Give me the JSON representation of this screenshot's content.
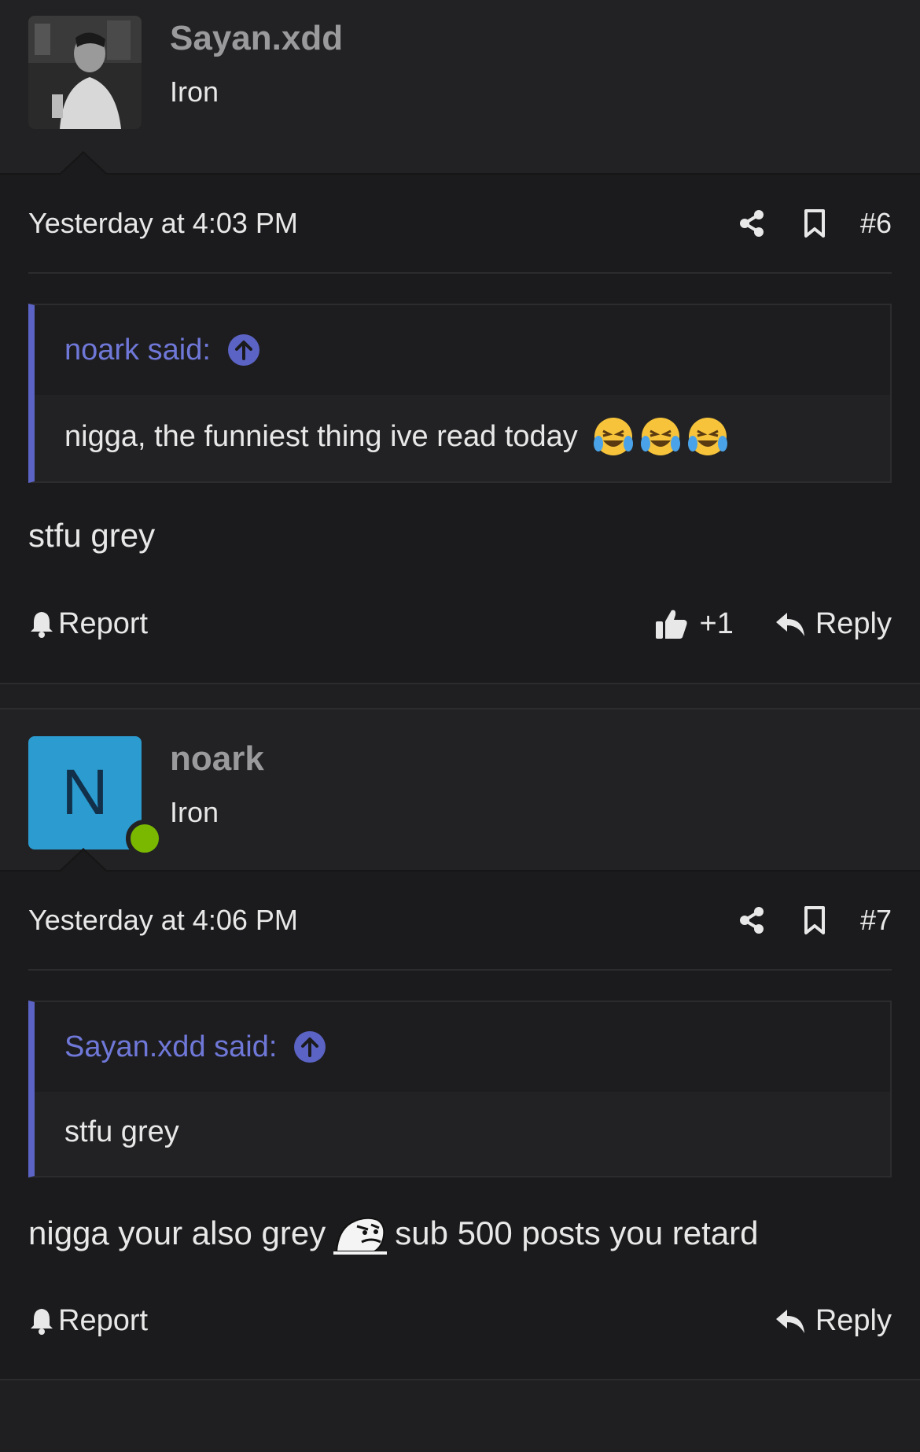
{
  "posts": [
    {
      "username": "Sayan.xdd",
      "rank": "Iron",
      "date": "Yesterday at 4:03 PM",
      "number": "#6",
      "quote_author": "noark said:",
      "quote_text": "nigga, the funniest thing ive read today",
      "message": "stfu grey",
      "report_label": "Report",
      "like_count": "+1",
      "reply_label": "Reply"
    },
    {
      "username": "noark",
      "rank": "Iron",
      "avatar_letter": "N",
      "date": "Yesterday at 4:06 PM",
      "number": "#7",
      "quote_author": "Sayan.xdd said:",
      "quote_text": "stfu grey",
      "message_part1": "nigga your also grey",
      "message_part2": "sub 500 posts you retard",
      "report_label": "Report",
      "reply_label": "Reply"
    }
  ],
  "colors": {
    "quote_accent": "#5b63c4",
    "online": "#7ab800",
    "avatar_bg": "#2b9bd0"
  },
  "icons": [
    "share-icon",
    "bookmark-icon",
    "arrow-up-circle-icon",
    "bell-icon",
    "thumbs-up-icon",
    "reply-icon",
    "laughing-crying-emoji-icon",
    "meme-face-icon"
  ]
}
